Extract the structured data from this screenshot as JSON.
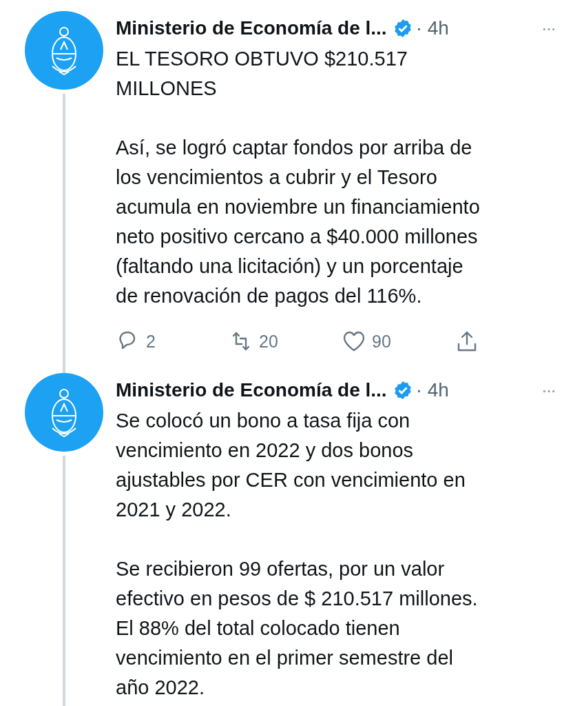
{
  "tweets": [
    {
      "author": "Ministerio de Economía de l...",
      "verified": true,
      "time": "· 4h",
      "more": "···",
      "paragraphs": [
        [
          "EL TESORO OBTUVO $210.517",
          "MILLONES"
        ],
        [
          "Así, se logró captar fondos por arriba de",
          "los vencimientos a cubrir y el Tesoro",
          "acumula en noviembre un financiamiento",
          "neto positivo cercano a $40.000 millones",
          "(faltando una licitación) y un porcentaje",
          "de renovación de pagos del 116%."
        ]
      ],
      "actions": [
        {
          "kind": "reply",
          "count": "2"
        },
        {
          "kind": "retweet",
          "count": "20"
        },
        {
          "kind": "like",
          "count": "90"
        },
        {
          "kind": "share"
        }
      ]
    },
    {
      "author": "Ministerio de Economía de l...",
      "verified": true,
      "time": "· 4h",
      "more": "···",
      "paragraphs": [
        [
          "Se colocó un bono a tasa fija con",
          "vencimiento en 2022 y dos bonos",
          "ajustables por CER con vencimiento en",
          "2021 y 2022."
        ],
        [
          "Se recibieron 99 ofertas, por un valor",
          "efectivo en pesos de $ 210.517 millones.",
          "El 88% del total colocado tienen",
          "vencimiento en el primer semestre del",
          "año 2022."
        ]
      ]
    }
  ]
}
